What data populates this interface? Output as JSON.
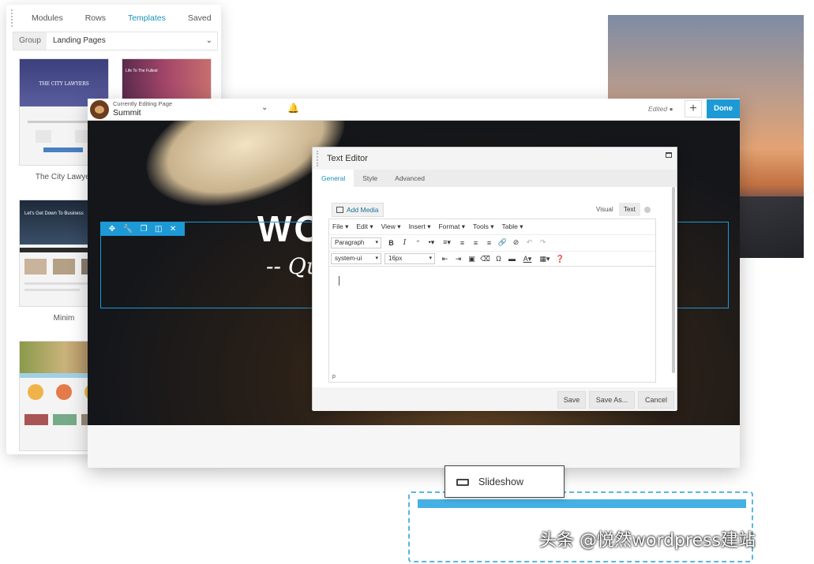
{
  "templates_panel": {
    "tabs": [
      "Modules",
      "Rows",
      "Templates",
      "Saved"
    ],
    "active_tab": "Templates",
    "filter_label": "Group",
    "filter_value": "Landing Pages",
    "thumb_texts": {
      "t1_hero": "THE CITY LAWYERS",
      "t2_hero": "Life To The Fullest",
      "t3_hero": "Let's Get Down To Business"
    },
    "template_names": [
      "The City Lawyer",
      "Minim"
    ]
  },
  "builder": {
    "editing_label": "Currently Editing Page",
    "page_name": "Summit",
    "status": "Edited",
    "done_label": "Done",
    "hero_title": "WOO",
    "hero_subtitle": "-- Qu"
  },
  "text_editor": {
    "title": "Text Editor",
    "tabs": [
      "General",
      "Style",
      "Advanced"
    ],
    "active_tab": "General",
    "add_media_label": "Add Media",
    "mode_visual": "Visual",
    "mode_text": "Text",
    "menu": [
      "File",
      "Edit",
      "View",
      "Insert",
      "Format",
      "Tools",
      "Table"
    ],
    "block_format": "Paragraph",
    "font_family": "system-ui",
    "font_size": "16px",
    "path": "p",
    "buttons": {
      "save": "Save",
      "save_as": "Save As...",
      "cancel": "Cancel"
    }
  },
  "module_drag": {
    "label": "Slideshow"
  },
  "watermark": "头条 @悦然wordpress建站",
  "colors": {
    "accent": "#1d9ad6",
    "drop_zone": "#45b0e3"
  }
}
